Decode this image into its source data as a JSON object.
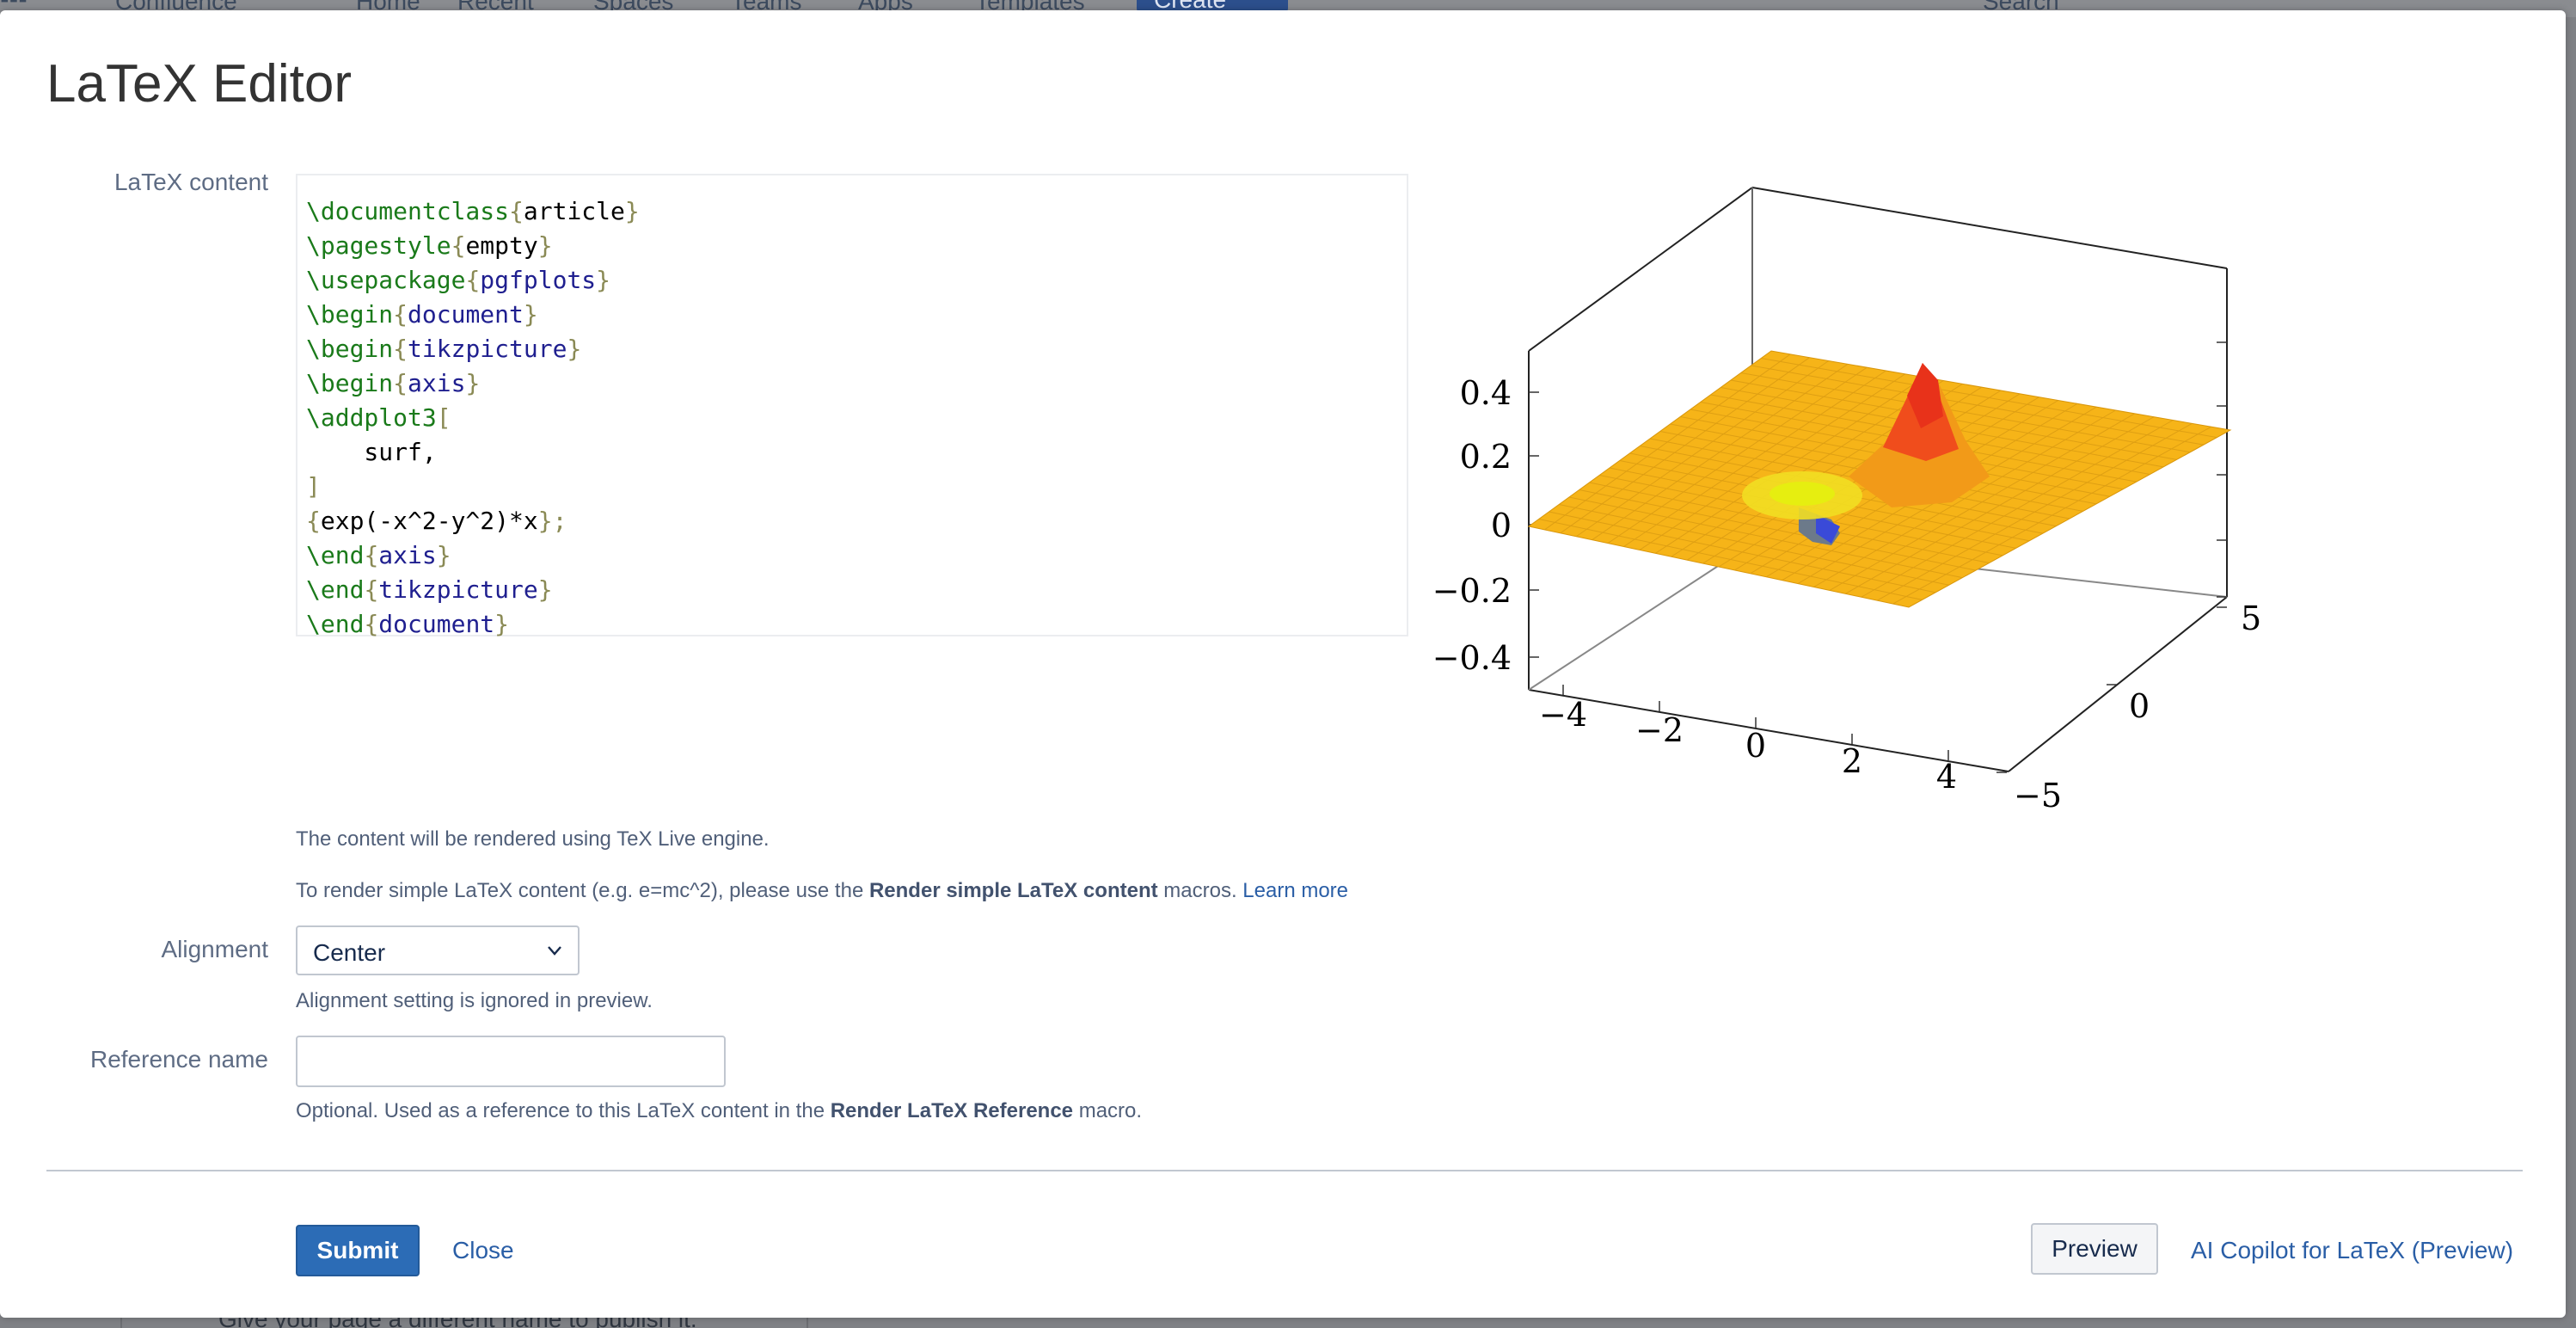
{
  "background": {
    "app_name": "Confluence",
    "nav": [
      "Home",
      "Recent",
      "Spaces",
      "Teams",
      "Apps",
      "Templates"
    ],
    "create_label": "Create",
    "search_placeholder": "Search",
    "footer_hint": "Give your page a different name to publish it."
  },
  "dialog": {
    "title": "LaTeX Editor",
    "content_label": "LaTeX content",
    "code_lines": [
      [
        {
          "t": "\\documentclass",
          "c": "cmd"
        },
        {
          "t": "{",
          "c": "br"
        },
        {
          "t": "article",
          "c": "txt"
        },
        {
          "t": "}",
          "c": "br"
        }
      ],
      [
        {
          "t": "\\pagestyle",
          "c": "cmd"
        },
        {
          "t": "{",
          "c": "br"
        },
        {
          "t": "empty",
          "c": "txt"
        },
        {
          "t": "}",
          "c": "br"
        }
      ],
      [
        {
          "t": "\\usepackage",
          "c": "cmd"
        },
        {
          "t": "{",
          "c": "br"
        },
        {
          "t": "pgfplots",
          "c": "arg"
        },
        {
          "t": "}",
          "c": "br"
        }
      ],
      [
        {
          "t": "\\begin",
          "c": "cmd"
        },
        {
          "t": "{",
          "c": "br"
        },
        {
          "t": "document",
          "c": "arg"
        },
        {
          "t": "}",
          "c": "br"
        }
      ],
      [
        {
          "t": "\\begin",
          "c": "cmd"
        },
        {
          "t": "{",
          "c": "br"
        },
        {
          "t": "tikzpicture",
          "c": "arg"
        },
        {
          "t": "}",
          "c": "br"
        }
      ],
      [
        {
          "t": "\\begin",
          "c": "cmd"
        },
        {
          "t": "{",
          "c": "br"
        },
        {
          "t": "axis",
          "c": "arg"
        },
        {
          "t": "}",
          "c": "br"
        }
      ],
      [
        {
          "t": "\\addplot3",
          "c": "cmd"
        },
        {
          "t": "[",
          "c": "br"
        }
      ],
      [
        {
          "t": "    surf,",
          "c": "txt"
        }
      ],
      [
        {
          "t": "]",
          "c": "br"
        }
      ],
      [
        {
          "t": "{",
          "c": "br"
        },
        {
          "t": "exp(-x^2-y^2)*x",
          "c": "txt"
        },
        {
          "t": "};",
          "c": "br"
        }
      ],
      [
        {
          "t": "\\end",
          "c": "cmd"
        },
        {
          "t": "{",
          "c": "br"
        },
        {
          "t": "axis",
          "c": "arg"
        },
        {
          "t": "}",
          "c": "br"
        }
      ],
      [
        {
          "t": "\\end",
          "c": "cmd"
        },
        {
          "t": "{",
          "c": "br"
        },
        {
          "t": "tikzpicture",
          "c": "arg"
        },
        {
          "t": "}",
          "c": "br"
        }
      ],
      [
        {
          "t": "\\end",
          "c": "cmd"
        },
        {
          "t": "{",
          "c": "br"
        },
        {
          "t": "document",
          "c": "arg"
        },
        {
          "t": "}",
          "c": "br"
        }
      ]
    ],
    "help_engine": "The content will be rendered using TeX Live engine.",
    "help_simple_prefix": "To render simple LaTeX content (e.g. e=mc^2), please use the ",
    "help_simple_bold": "Render simple LaTeX content",
    "help_simple_suffix": " macros. ",
    "learn_more": "Learn more",
    "alignment_label": "Alignment",
    "alignment_value": "Center",
    "alignment_help": "Alignment setting is ignored in preview.",
    "reference_label": "Reference name",
    "reference_value": "",
    "reference_help_prefix": "Optional. Used as a reference to this LaTeX content in the ",
    "reference_help_bold": "Render LaTeX Reference",
    "reference_help_suffix": " macro.",
    "submit": "Submit",
    "close": "Close",
    "preview": "Preview",
    "ai_copilot": "AI Copilot for LaTeX (Preview)"
  },
  "preview_plot": {
    "z_ticks": [
      "0.4",
      "0.2",
      "0",
      "−0.2",
      "−0.4"
    ],
    "x_ticks": [
      "−4",
      "−2",
      "0",
      "2",
      "4"
    ],
    "y_ticks": [
      "5",
      "0",
      "−5"
    ]
  },
  "colors": {
    "primary": "#2c6cb6",
    "link": "#2a5ea6",
    "surface_flat": "#f6b418",
    "surface_peak": "#e8321a",
    "surface_trough": "#3a4ad8"
  }
}
